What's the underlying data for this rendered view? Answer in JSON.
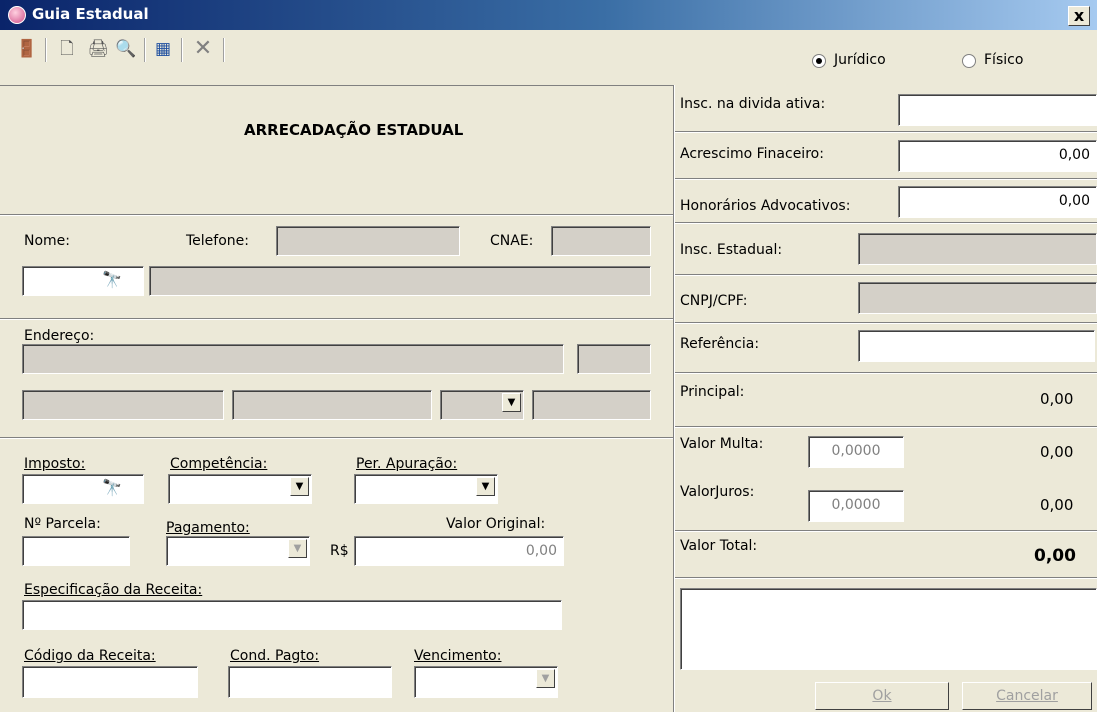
{
  "window": {
    "title": "Guia Estadual",
    "close": "x"
  },
  "toolbar": {
    "exit_icon": "exit-door-icon",
    "new_icon": "new-page-icon",
    "print_icon": "printer-icon",
    "preview_icon": "print-preview-icon",
    "calendar_icon": "report-icon",
    "delete_icon": "delete-x-icon"
  },
  "person_type": {
    "juridico": "Jurídico",
    "fisico": "Físico",
    "selected": "juridico"
  },
  "header": {
    "title": "ARRECADAÇÃO ESTADUAL"
  },
  "contribuinte": {
    "nome_label": "Nome:",
    "telefone_label": "Telefone:",
    "cnae_label": "CNAE:",
    "endereco_label": "Endereço:"
  },
  "imposto": {
    "imposto_label": "Imposto:",
    "competencia_label": "Competência:",
    "per_apuracao_label": "Per. Apuração:",
    "parcela_label": "Nº Parcela:",
    "pagamento_label": "Pagamento:",
    "valor_original_label": "Valor Original:",
    "currency": "R$",
    "valor_original": "0,00",
    "especificacao_label": "Especificação da Receita:",
    "codigo_label": "Código da Receita:",
    "cond_pagto_label": "Cond. Pagto:",
    "vencimento_label": "Vencimento:"
  },
  "right": {
    "insc_divida_label": "Insc. na divida ativa:",
    "acrescimo_label": "Acrescimo Finaceiro:",
    "acrescimo_value": "0,00",
    "honorarios_label": "Honorários Advocativos:",
    "honorarios_value": "0,00",
    "insc_estadual_label": "Insc. Estadual:",
    "cnpj_label": "CNPJ/CPF:",
    "referencia_label": "Referência:",
    "principal_label": "Principal:",
    "principal_value": "0,00",
    "multa_label": "Valor Multa:",
    "multa_rate": "0,0000",
    "multa_value": "0,00",
    "juros_label": "ValorJuros:",
    "juros_rate": "0,0000",
    "juros_value": "0,00",
    "total_label": "Valor Total:",
    "total_value": "0,00"
  },
  "buttons": {
    "ok": "Ok",
    "cancelar": "Cancelar"
  }
}
